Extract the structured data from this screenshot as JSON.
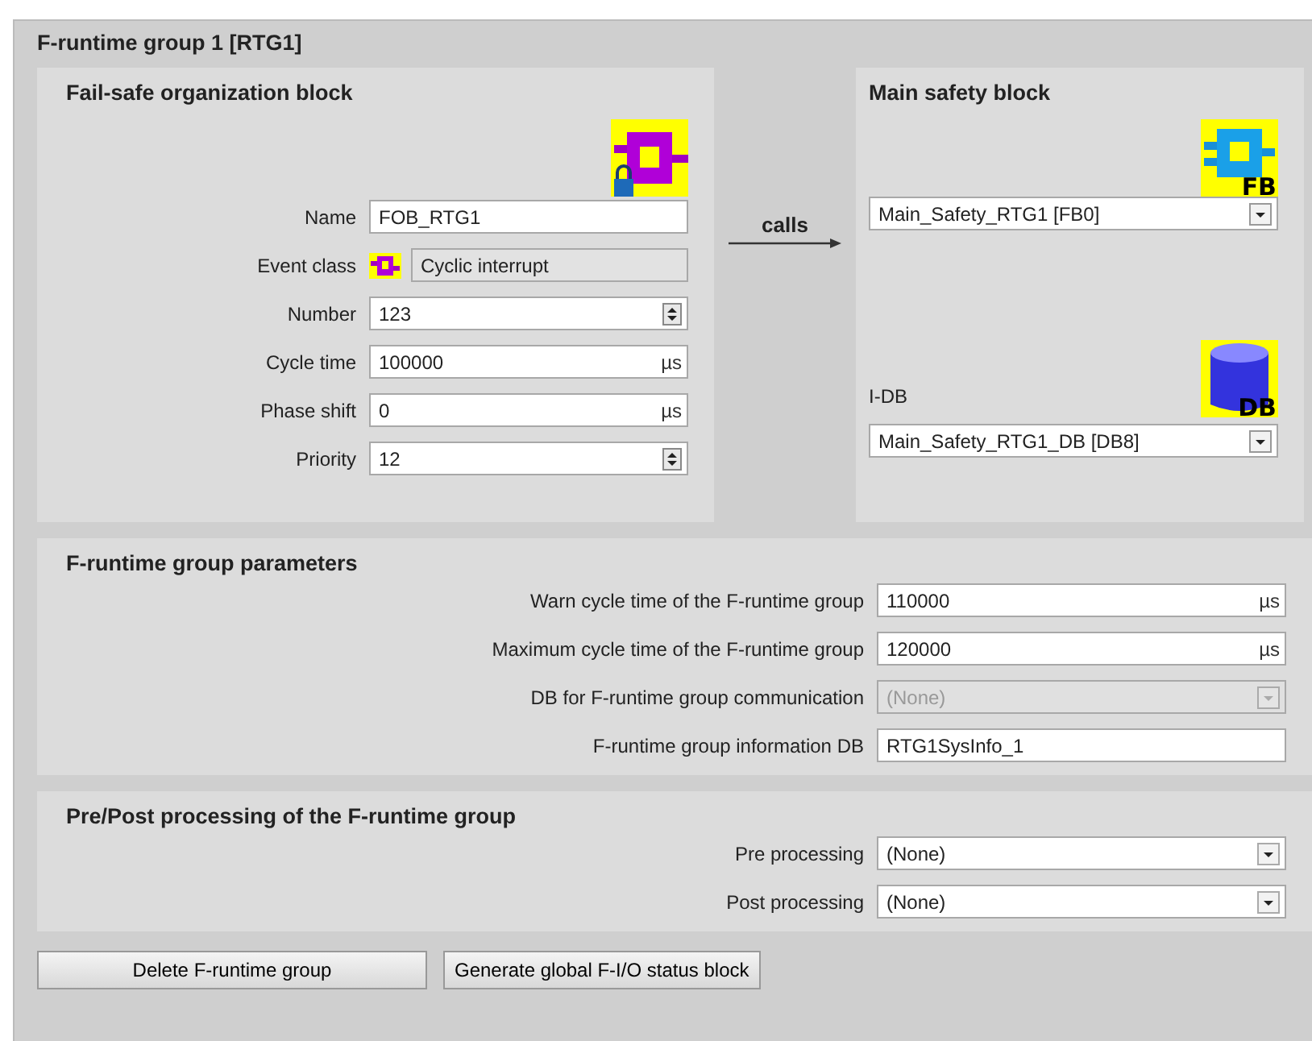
{
  "group_title": "F-runtime group 1 [RTG1]",
  "fob": {
    "title": "Fail-safe organization block",
    "fields": [
      {
        "label": "Name",
        "kind": "text",
        "value": "FOB_RTG1"
      },
      {
        "label": "Event class",
        "kind": "readonly",
        "value": "Cyclic interrupt"
      },
      {
        "label": "Number",
        "kind": "spin",
        "value": "123"
      },
      {
        "label": "Cycle time",
        "kind": "unit",
        "value": "100000",
        "unit": "µs"
      },
      {
        "label": "Phase shift",
        "kind": "unit",
        "value": "0",
        "unit": "µs"
      },
      {
        "label": "Priority",
        "kind": "spin",
        "value": "12"
      }
    ]
  },
  "calls": "calls",
  "main": {
    "title": "Main safety block",
    "fb_icon_text": "FB",
    "block": "Main_Safety_RTG1 [FB0]",
    "idb_label": "I-DB",
    "db_icon_text": "DB",
    "idb": "Main_Safety_RTG1_DB [DB8]"
  },
  "params": {
    "title": "F-runtime group parameters",
    "fields": [
      {
        "label": "Warn cycle time of the F-runtime group",
        "kind": "unit",
        "value": "110000",
        "unit": "µs",
        "disabled": false
      },
      {
        "label": "Maximum cycle time of the F-runtime group",
        "kind": "unit",
        "value": "120000",
        "unit": "µs",
        "disabled": false
      },
      {
        "label": "DB for F-runtime group communication",
        "kind": "dropdown",
        "value": "(None)",
        "disabled": true
      },
      {
        "label": "F-runtime group information DB",
        "kind": "text",
        "value": "RTG1SysInfo_1",
        "disabled": false
      }
    ]
  },
  "prepost": {
    "title": "Pre/Post processing of the F-runtime group",
    "fields": [
      {
        "label": "Pre processing",
        "kind": "dropdown",
        "value": "(None)",
        "disabled": false
      },
      {
        "label": "Post processing",
        "kind": "dropdown",
        "value": "(None)",
        "disabled": false
      }
    ]
  },
  "buttons": [
    "Delete F-runtime group",
    "Generate global F-I/O status block"
  ]
}
